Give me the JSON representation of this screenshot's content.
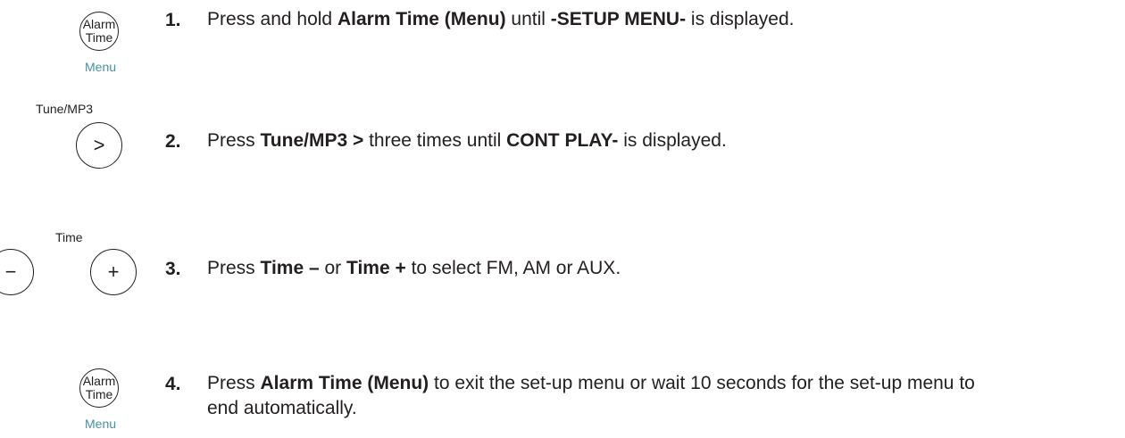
{
  "steps": [
    {
      "number": "1.",
      "button": {
        "line1": "Alarm",
        "line2": "Time",
        "caption": "Menu"
      },
      "parts": [
        "Press and hold ",
        "Alarm Time (Menu)",
        " until ",
        "-SETUP MENU-",
        " is displayed."
      ]
    },
    {
      "number": "2.",
      "button": {
        "label": "Tune/MP3",
        "symbol": ">"
      },
      "parts": [
        "Press ",
        "Tune/MP3 >",
        " three times until ",
        "CONT PLAY-",
        " is displayed."
      ]
    },
    {
      "number": "3.",
      "button": {
        "label": "Time",
        "minus": "−",
        "plus": "+"
      },
      "parts": [
        "Press ",
        "Time –",
        " or ",
        "Time +",
        " to select FM, AM or AUX."
      ]
    },
    {
      "number": "4.",
      "button": {
        "line1": "Alarm",
        "line2": "Time",
        "caption": "Menu"
      },
      "parts": [
        "Press ",
        "Alarm Time (Menu)",
        " to exit the set-up menu or wait 10 seconds for the set-up menu to end automatically."
      ]
    }
  ]
}
